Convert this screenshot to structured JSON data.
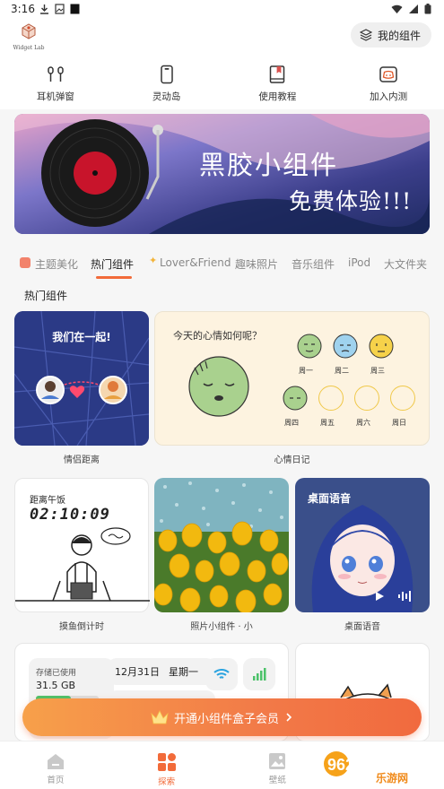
{
  "status_bar": {
    "time": "3:16"
  },
  "header": {
    "logo_text": "Widget Lab",
    "my_widgets_label": "我的组件"
  },
  "quick_nav": [
    {
      "label": "耳机弹窗",
      "icon": "earbuds-icon"
    },
    {
      "label": "灵动岛",
      "icon": "phone-island-icon"
    },
    {
      "label": "使用教程",
      "icon": "book-icon"
    },
    {
      "label": "加入内测",
      "icon": "discord-icon"
    }
  ],
  "banner": {
    "line1": "黑胶小组件",
    "line2": "免费体验!!!"
  },
  "tabs": [
    {
      "label": "主题美化",
      "active": false
    },
    {
      "label": "热门组件",
      "active": true
    },
    {
      "label": "Lover&Friend",
      "active": false
    },
    {
      "label": "趣味照片",
      "active": false
    },
    {
      "label": "音乐组件",
      "active": false
    },
    {
      "label": "iPod",
      "active": false
    },
    {
      "label": "大文件夹",
      "active": false
    }
  ],
  "section_title": "热门组件",
  "widgets": {
    "couple": {
      "title": "我们在一起!",
      "caption": "情侣距离"
    },
    "mood": {
      "title": "今天的心情如何呢？",
      "caption": "心情日记",
      "days": [
        "周一",
        "周二",
        "周三",
        "周四",
        "周五",
        "周六",
        "周日"
      ]
    },
    "lunch": {
      "label": "距离午饭",
      "time": "02:10:09",
      "caption": "摸鱼倒计时"
    },
    "photo": {
      "caption": "照片小组件 · 小"
    },
    "voice": {
      "title": "桌面语音",
      "caption": "桌面语音"
    },
    "system": {
      "storage_label": "存储已使用",
      "storage_value": "31.5 GB",
      "storage_fraction": 0.55,
      "date": "12月31日",
      "weekday": "星期一"
    }
  },
  "vip_button": {
    "label": "开通小组件盒子会员"
  },
  "bottom_nav": [
    {
      "label": "首页",
      "active": false
    },
    {
      "label": "探索",
      "active": true
    },
    {
      "label": "壁纸",
      "active": false
    }
  ],
  "watermark": {
    "big": "962.NET",
    "small": "乐游网"
  },
  "colors": {
    "accent": "#f26b3a",
    "mood_green": "#a9d18e",
    "mood_blue": "#9fd2ee",
    "mood_yellow": "#f6d24a"
  }
}
